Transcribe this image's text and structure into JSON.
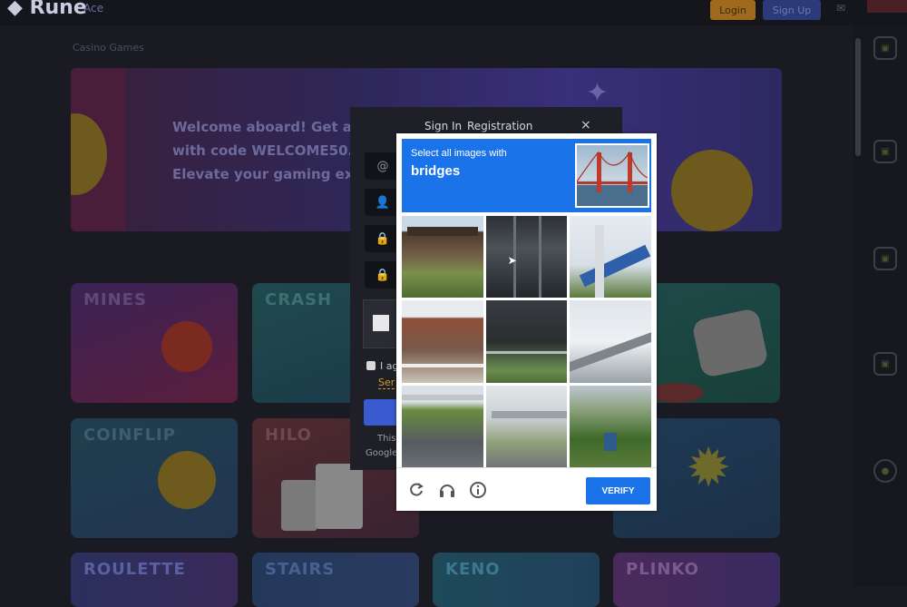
{
  "site": {
    "logo": "Rune",
    "logo_sub": "Ace",
    "login_label": "Login",
    "signup_label": "Sign Up",
    "breadcrumb": "Casino Games",
    "banner_lines": [
      "Welcome aboard! Get a S",
      "with code WELCOME50.",
      "Elevate your gaming exp"
    ],
    "games": [
      "MINES",
      "CRASH",
      "COINFLIP",
      "HILO",
      "ROULETTE",
      "STAIRS",
      "KENO",
      "PLINKO"
    ]
  },
  "registration": {
    "tab_signin": "Sign In",
    "tab_registration": "Registration",
    "close": "×",
    "agree_text": "I ag",
    "terms_link": "Ser",
    "footer_1": "This",
    "footer_2": "Google"
  },
  "captcha": {
    "instruction": "Select all images with",
    "target": "bridges",
    "verify_label": "VERIFY",
    "accent": "#1a73e8",
    "icons": [
      "refresh-icon",
      "audio-icon",
      "info-icon"
    ]
  }
}
